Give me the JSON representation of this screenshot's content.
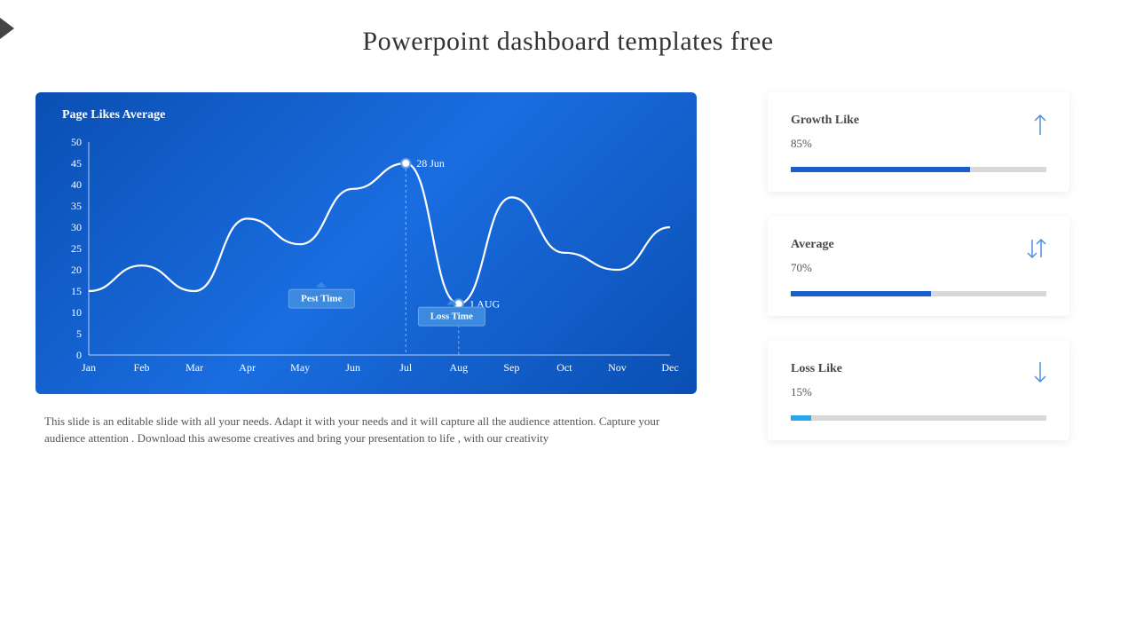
{
  "title": "Powerpoint dashboard templates free",
  "chart_data": {
    "type": "line",
    "title": "Page Likes Average",
    "xlabel": "",
    "ylabel": "",
    "ylim": [
      0,
      50
    ],
    "categories": [
      "Jan",
      "Feb",
      "Mar",
      "Apr",
      "May",
      "Jun",
      "Jul",
      "Aug",
      "Sep",
      "Oct",
      "Nov",
      "Dec"
    ],
    "values": [
      15,
      21,
      15,
      32,
      26,
      39,
      45,
      12,
      37,
      24,
      20,
      30
    ],
    "y_ticks": [
      0,
      5,
      10,
      15,
      20,
      25,
      30,
      35,
      40,
      45,
      50
    ],
    "annotations": [
      {
        "label": "28 Jun",
        "x_index": 6,
        "y": 45,
        "callout": "Pest Time"
      },
      {
        "label": "1 AUG",
        "x_index": 7,
        "y": 12,
        "callout": "Loss Time"
      }
    ]
  },
  "description": "This slide is an editable slide with all your needs. Adapt it with your needs and it will capture all the audience attention. Capture your audience attention . Download this awesome creatives and bring your presentation to life , with our creativity",
  "stats": [
    {
      "title": "Growth Like",
      "value_label": "85%",
      "value": 85,
      "icon": "arrow-up",
      "fill_color": "#1a5fc9",
      "fill_pct": 70
    },
    {
      "title": "Average",
      "value_label": "70%",
      "value": 70,
      "icon": "arrow-up-down",
      "fill_color": "#1a5fc9",
      "fill_pct": 55
    },
    {
      "title": "Loss Like",
      "value_label": "15%",
      "value": 15,
      "icon": "arrow-down",
      "fill_color": "#2aa7e8",
      "fill_pct": 8
    }
  ]
}
